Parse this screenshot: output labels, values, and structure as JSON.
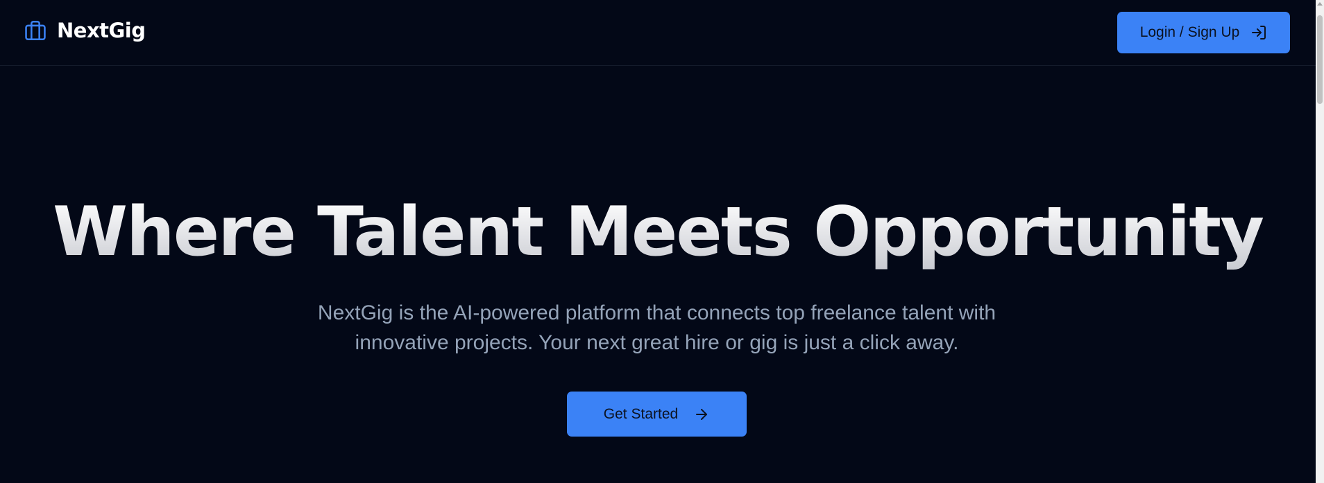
{
  "brand": {
    "name": "NextGig",
    "icon": "briefcase-icon",
    "accent_color": "#3b82f6"
  },
  "header": {
    "login_label": "Login / Sign Up",
    "login_icon": "log-in-icon"
  },
  "hero": {
    "title": "Where Talent Meets Opportunity",
    "subtitle": "NextGig is the AI-powered platform that connects top freelance talent with innovative projects. Your next great hire or gig is just a click away.",
    "cta_label": "Get Started",
    "cta_icon": "arrow-right-icon"
  },
  "colors": {
    "background": "#030817",
    "subtitle_text": "#94a3b8",
    "button_bg": "#3b82f6",
    "button_text": "#0b1220"
  }
}
